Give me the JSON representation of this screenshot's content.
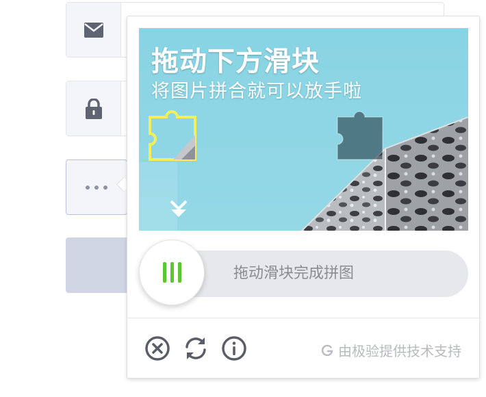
{
  "form": {
    "fields": [
      {
        "name": "email",
        "icon": "mail-icon"
      },
      {
        "name": "password",
        "icon": "lock-icon"
      },
      {
        "name": "captcha",
        "icon": "dots-icon"
      }
    ]
  },
  "captcha": {
    "title": "拖动下方滑块",
    "subtitle": "将图片拼合就可以放手啦",
    "slider_hint": "拖动滑块完成拼图",
    "brand": "由极验提供技术支持",
    "icons": {
      "close": "close-circle-icon",
      "refresh": "refresh-icon",
      "info": "info-circle-icon",
      "brand": "geetest-logo-icon"
    },
    "colors": {
      "accent": "#5cc633",
      "image_bg": "#8fd6e5",
      "hint_text": "#8a8c91",
      "brand_text": "#b8babf"
    }
  }
}
